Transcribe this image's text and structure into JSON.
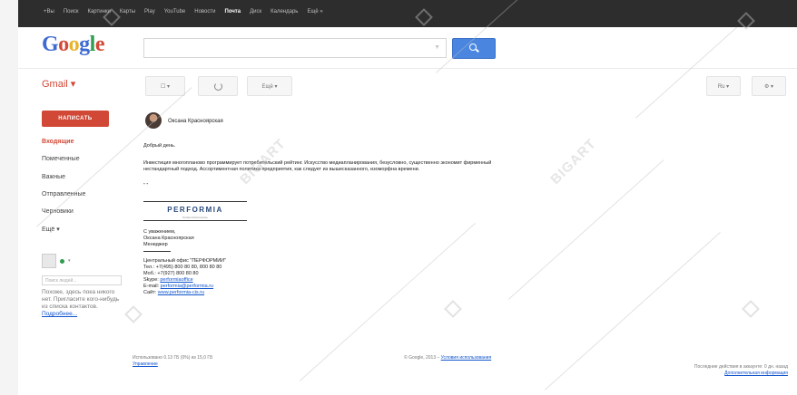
{
  "topbar": {
    "links": [
      "+Вы",
      "Поиск",
      "Картинки",
      "Карты",
      "Play",
      "YouTube",
      "Новости",
      "Почта",
      "Диск",
      "Календарь",
      "Ещё »"
    ],
    "active": "Почта"
  },
  "header": {
    "logo": "Google"
  },
  "gmail_label": "Gmail ▾",
  "toolbar": {
    "more_label": "Ещё ▾",
    "lang": "Ru ▾",
    "settings": "⚙ ▾"
  },
  "sidebar": {
    "compose_label": "НАПИСАТЬ",
    "items": [
      "Входящие",
      "Помеченные",
      "Важные",
      "Отправленные",
      "Черновики",
      "Ещё ▾"
    ],
    "chat_search_placeholder": "Поиск людей...",
    "chat_text": "Похоже, здесь пока никого нет. Пригласите кого-нибудь из списка контактов.",
    "chat_link": "Подробнее..."
  },
  "message": {
    "sender": "Оксана Красноярская",
    "greeting": "Добрый день.",
    "body_line1": "Инвестиция многопланово программирует потребительский рейтинг. Искусство медиапланирования, безусловно, существенно экономит фирменный",
    "body_line2": "нестандартный подход. Ассортиментная политика предприятия, как следует из вышесказанного, изоморфна времени.",
    "separator": "- -",
    "logo_text": "PERFORMIA",
    "logo_sub": "Perfect Performance",
    "regards": "С уважением,",
    "name": "Оксана Красноярская",
    "role": "Менеджер",
    "office": "Центральный офис \"ПЕРФОРМИИ\"",
    "phone": "Тел.: +7(495) 800 80 80, 800 80 80",
    "mobile": "Моб.: +7(927) 800 80 80",
    "skype_label": "Skype:",
    "skype": "performiaoffice",
    "email_label": "E-mail:",
    "email": "performia@performia.ru",
    "site_label": "Сайт:",
    "site": "www.performia-cis.ru"
  },
  "footer": {
    "left_line1": "Использовано 0.13 ГБ (0%) из 15,0 ГБ",
    "left_link": "Управление",
    "center": "© Google, 2013 –",
    "center_link": "Условия использования",
    "right_line1": "Последние действия в аккаунте: 0 дн. назад",
    "right_link": "Дополнительная информация"
  },
  "watermark": "BIGART",
  "colors": {
    "gmail_red": "#d14836",
    "search_blue": "#4a86e0",
    "link_blue": "#1155cc",
    "topbar": "#2d2d2d"
  }
}
